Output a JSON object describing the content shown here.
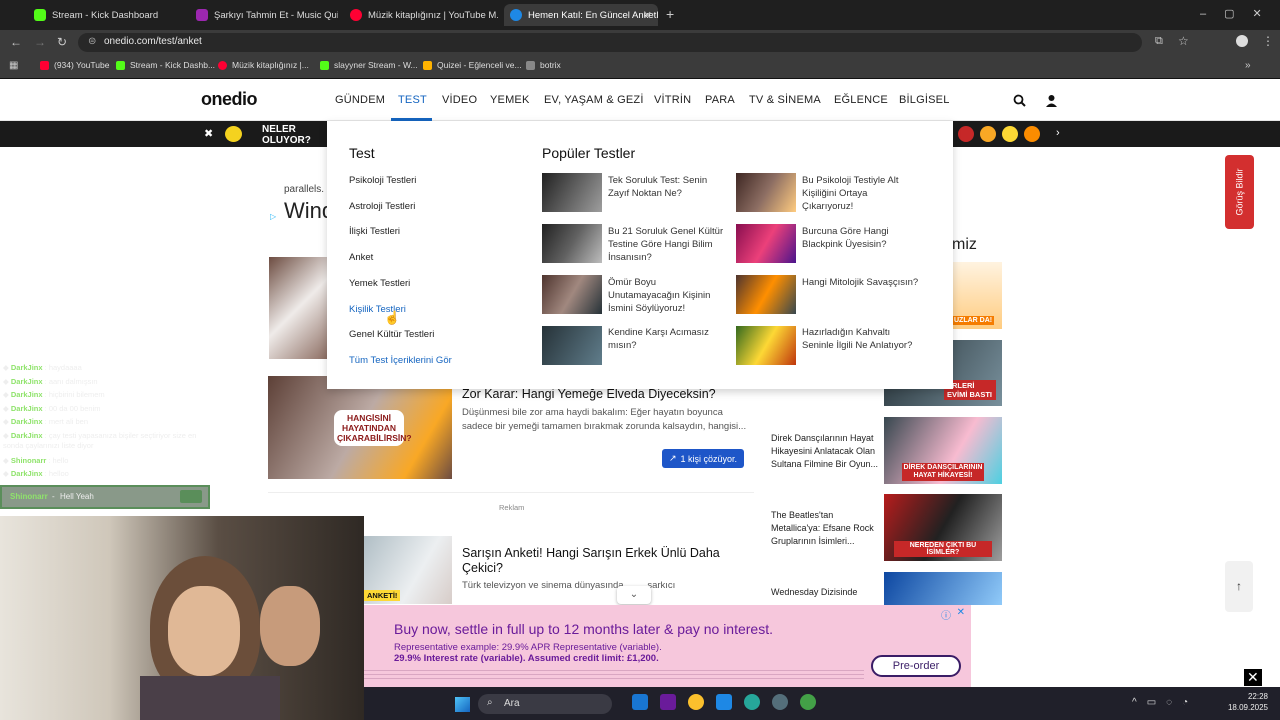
{
  "browser": {
    "tabs": [
      {
        "title": "Stream - Kick Dashboard",
        "color": "#53fc18"
      },
      {
        "title": "Şarkıyı Tahmin Et - Music Quiz",
        "color": "#9c27b0"
      },
      {
        "title": "Müzik kitaplığınız | YouTube M...",
        "color": "#ff0033"
      },
      {
        "title": "Hemen Katıl: En Güncel Anketl...",
        "color": "#1e88e5"
      }
    ],
    "url": "onedio.com/test/anket",
    "bookmarks": [
      {
        "label": "(934) YouTube",
        "color": "#ff0033"
      },
      {
        "label": "Stream - Kick Dashb...",
        "color": "#53fc18"
      },
      {
        "label": "Müzik kitaplığınız |...",
        "color": "#ff0033"
      },
      {
        "label": "slayyner Stream - W...",
        "color": "#53fc18"
      },
      {
        "label": "Quizei - Eğlenceli ve...",
        "color": "#ffb300"
      },
      {
        "label": "botrix",
        "color": "#888888"
      }
    ]
  },
  "site": {
    "logo": "onedio",
    "nav": [
      "GÜNDEM",
      "TEST",
      "VİDEO",
      "YEMEK",
      "EV, YAŞAM & GEZİ",
      "VİTRİN",
      "PARA",
      "TV & SİNEMA",
      "EĞLENCE",
      "BİLGİSEL"
    ],
    "active_nav": "TEST",
    "strip_label": "NELER OLUYOR?",
    "feedback": "Görüş Bildir"
  },
  "dropdown": {
    "col1_title": "Test",
    "links": [
      "Psikoloji Testleri",
      "Astroloji Testleri",
      "İlişki Testleri",
      "Anket",
      "Yemek Testleri",
      "Kişilik Testleri",
      "Genel Kültür Testleri",
      "Tüm Test İçeriklerini Gör"
    ],
    "popular_title": "Popüler Testler",
    "popular": [
      "Tek Soruluk Test: Senin Zayıf Noktan Ne?",
      "Bu Psikoloji Testiyle Alt Kişiliğini Ortaya Çıkarıyoruz!",
      "Bu 21 Soruluk Genel Kültür Testine Göre Hangi Bilim İnsanısın?",
      "Burcuna Göre Hangi Blackpink Üyesisin?",
      "Ömür Boyu Unutamayacağın Kişinin İsmini Söylüyoruz!",
      "Hangi Mitolojik Savaşçısın?",
      "Kendine Karşı Acımasız mısın?",
      "Hazırladığın Kahvaltı Seninle İlgili Ne Anlatıyor?"
    ]
  },
  "content": {
    "partial_title": "Wind",
    "partial_source": "parallels.",
    "card1": {
      "title": "Zor Karar: Hangi Yemeğe Elveda Diyeceksin?",
      "desc": "Düşünmesi bile zor ama haydi bakalım: Eğer hayatın boyunca sadece bir yemeği tamamen bırakmak zorunda kalsaydın, hangisi...",
      "badge": "1 kişi çözüyor.",
      "thumb_text": "HANGİSİNİ HAYATINDAN ÇIKARABİLİRSİN?"
    },
    "ad_label": "Reklam",
    "card2": {
      "title": "Sarışın Anketi! Hangi Sarışın Erkek Ünlü Daha Çekici?",
      "desc": "Türk televizyon ve sinema dünyasında ... ... şarkıcı",
      "thumb_text": "ANKETİ!"
    },
    "side": [
      {
        "title": "Direk Dansçılarının Hayat Hikayesini Anlatacak Olan Sultana Filmine Bir Oyun...",
        "thumb_text": "DİREK DANSÇILARININ HAYAT HİKAYESİ!"
      },
      {
        "title": "The Beatles'tan Metallica'ya: Efsane Rock Gruplarının İsimleri...",
        "thumb_text": "NEREDEN ÇIKTI BU İSİMLER?"
      },
      {
        "title": "Wednesday Dizisinde",
        "thumb_text": ""
      }
    ],
    "side_right_partial": "miz",
    "side_top_thumbs": [
      "UZLAR DA!",
      "ERLERİ EVİMİ BASTI"
    ]
  },
  "chat": [
    {
      "user": "DarkJinx",
      "msg": "haydaaaa"
    },
    {
      "user": "DarkJinx",
      "msg": "aanı dalmışsın"
    },
    {
      "user": "DarkJinx",
      "msg": "hiçbirini bilemem"
    },
    {
      "user": "DarkJinx",
      "msg": "00 da 00 benim"
    },
    {
      "user": "DarkJinx",
      "msg": "mert ali ben"
    },
    {
      "user": "DarkJinx",
      "msg": "çay testi yapasanıza bişiler seçtiriyor size en"
    },
    {
      "user": "",
      "msg": "sonda çaylarınızı liste diyor"
    },
    {
      "user": "Shinonarr",
      "msg": "hello"
    },
    {
      "user": "DarkJinx",
      "msg": "helloo"
    }
  ],
  "chat_highlight": {
    "user": "Shinonarr",
    "msg": "Hell Yeah"
  },
  "ad": {
    "headline": "Buy now, settle in full up to 12 months later & pay no interest.",
    "line1": "Representative example: 29.9% APR Representative (variable).",
    "line2": "29.9% Interest rate (variable). Assumed credit limit: £1,200.",
    "cta": "Pre-order"
  },
  "taskbar": {
    "search": "Ara",
    "time": "22:28",
    "date": "18.09.2025"
  }
}
